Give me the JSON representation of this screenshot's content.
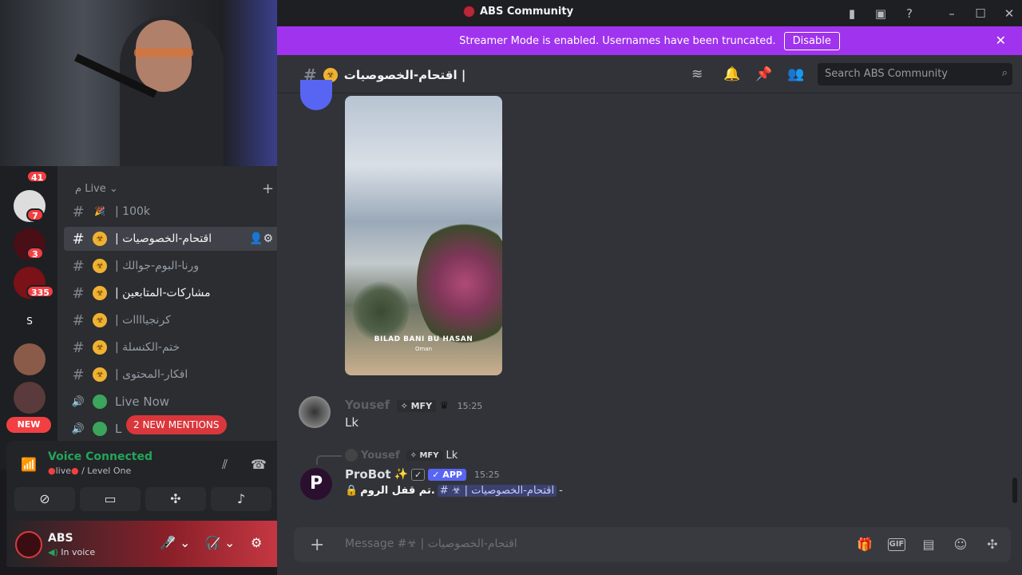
{
  "window": {
    "title": "ABS Community"
  },
  "banner": {
    "text": "Streamer Mode is enabled. Usernames have been truncated.",
    "button": "Disable"
  },
  "guilds": {
    "badges": [
      "41",
      "7",
      "3",
      "335"
    ],
    "letter_icon": "S",
    "new_pill": "NEW"
  },
  "sidebar": {
    "category": "م Live",
    "channels": [
      {
        "prefix": "#",
        "emoji": "🎉",
        "name": "| 100k"
      },
      {
        "prefix": "#",
        "emoji": "☣",
        "name": "| اقتحام-الخصوصيات"
      },
      {
        "prefix": "#",
        "emoji": "☣",
        "name": "| ورنا-البوم-جوالك"
      },
      {
        "prefix": "#",
        "emoji": "☣",
        "name": "| مشاركات-المتابعين"
      },
      {
        "prefix": "#",
        "emoji": "☣",
        "name": "| كرنجياااات"
      },
      {
        "prefix": "#",
        "emoji": "☣",
        "name": "| ختم-الكنسلة"
      },
      {
        "prefix": "#",
        "emoji": "☣",
        "name": "| افكار-المحتوى"
      },
      {
        "prefix": "🔊",
        "emoji": "●",
        "name": "Live Now"
      },
      {
        "prefix": "🔊",
        "emoji": "●",
        "name": "L"
      }
    ],
    "mentions_pill": "2 NEW MENTIONS"
  },
  "voice": {
    "status": "Voice Connected",
    "channel_live": "live",
    "channel_sep": "/ Level One"
  },
  "user": {
    "name": "ABS",
    "status": "In voice"
  },
  "channel_header": {
    "name": "اقتحام-الخصوصيات |",
    "emoji": "☣",
    "search_placeholder": "Search ABS Community"
  },
  "photo": {
    "caption": "BILAD BANI BU HASAN",
    "sub": "Oman"
  },
  "messages": [
    {
      "author": "Yousef",
      "tag": "✧ MFY",
      "crown": "♛",
      "time": "15:25",
      "text": "Lk"
    },
    {
      "reply_author": "Yousef",
      "reply_tag": "✧ MFY",
      "reply_text": "Lk",
      "author": "ProBot",
      "sparkle": "✨",
      "check": "✓",
      "app": "✓ APP",
      "time": "15:25",
      "lock": "🔒",
      "text": "تم قفل الروم.",
      "mention": "# ☣ | اقتحام-الخصوصيات",
      "trail": "-"
    }
  ],
  "composer": {
    "placeholder": "Message #☣ | اقتحام-الخصوصيات"
  },
  "colors": {
    "blurple": "#5865f2",
    "banner": "#a033ee",
    "green": "#23a55a",
    "red": "#f23f43"
  }
}
